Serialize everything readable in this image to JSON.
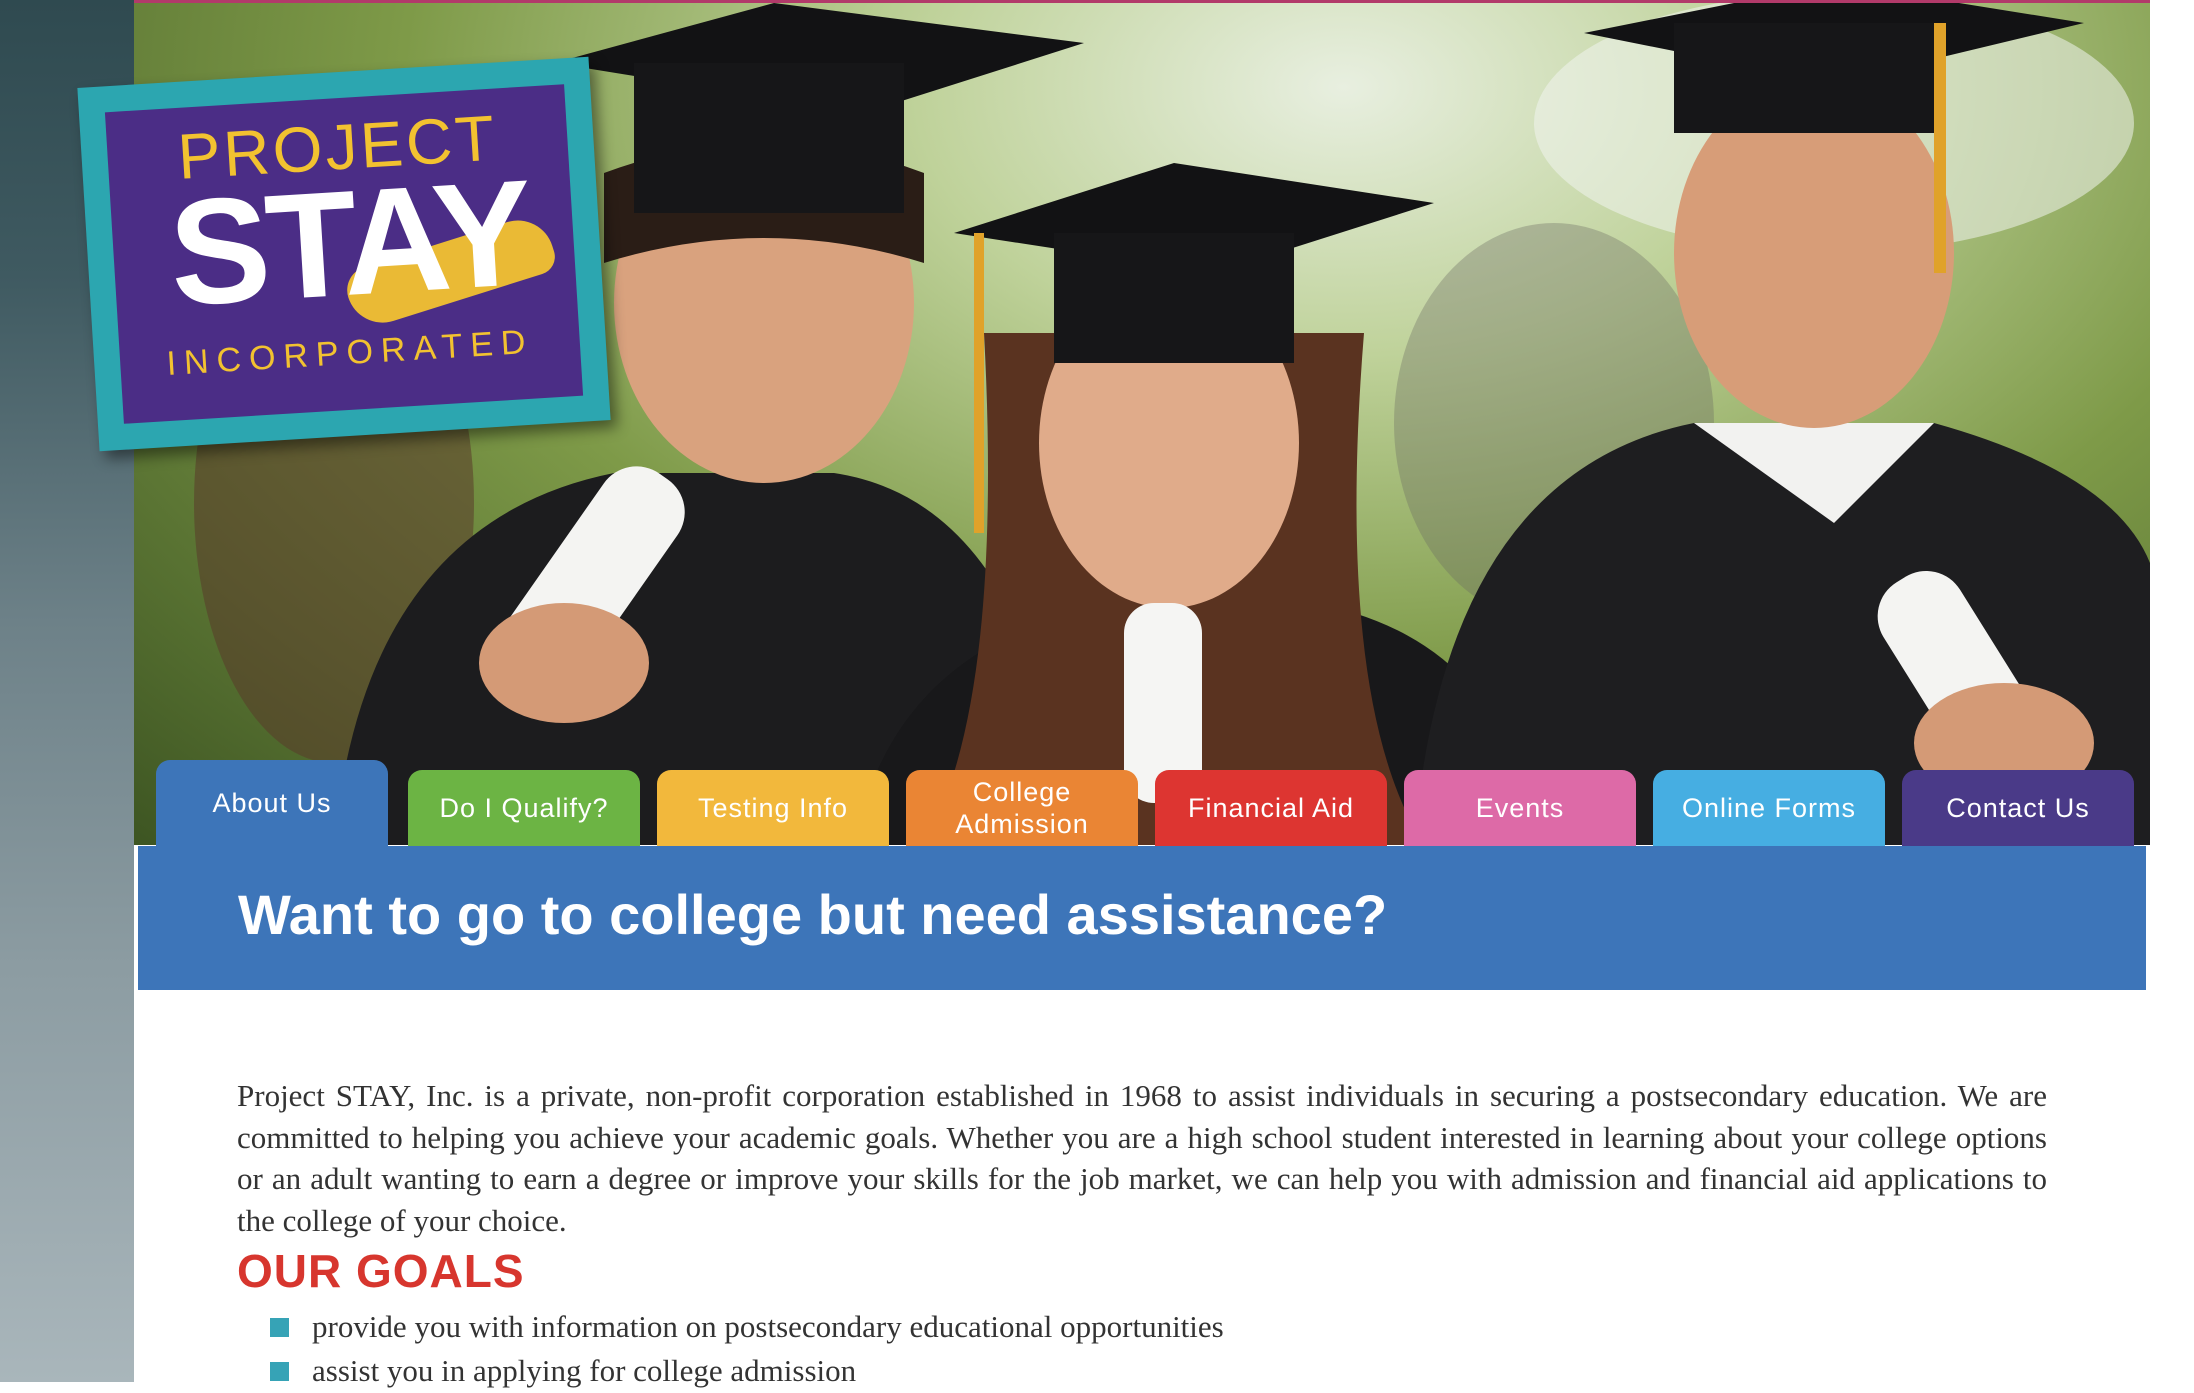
{
  "logo": {
    "line1": "PROJECT",
    "line2": "STAY",
    "line3": "INCORPORATED"
  },
  "nav": {
    "tabs": [
      {
        "label": "About Us",
        "color": "#3d75b9",
        "active": true
      },
      {
        "label": "Do I Qualify?",
        "color": "#6cb444",
        "active": false
      },
      {
        "label": "Testing Info",
        "color": "#f2b83c",
        "active": false
      },
      {
        "label": "College Admission",
        "color": "#ea8534",
        "active": false
      },
      {
        "label": "Financial Aid",
        "color": "#dd3531",
        "active": false
      },
      {
        "label": "Events",
        "color": "#dd6aa7",
        "active": false
      },
      {
        "label": "Online Forms",
        "color": "#46aee2",
        "active": false
      },
      {
        "label": "Contact Us",
        "color": "#4a3a88",
        "active": false
      }
    ]
  },
  "heading": {
    "text": "Want to go to college but need assistance?"
  },
  "intro": {
    "text": "Project STAY, Inc. is a private, non-profit corporation established in 1968 to assist individuals in securing a postsecondary education. We are committed to helping you achieve your academic goals. Whether you are a high school student interested in learning about your college options or an adult wanting to earn a degree or improve your skills for the job market, we can help you with admission and financial aid applications to the college of your choice."
  },
  "goals": {
    "title": "OUR GOALS",
    "items": [
      "provide you with information on postsecondary educational opportunities",
      "assist you in applying for college admission"
    ]
  }
}
